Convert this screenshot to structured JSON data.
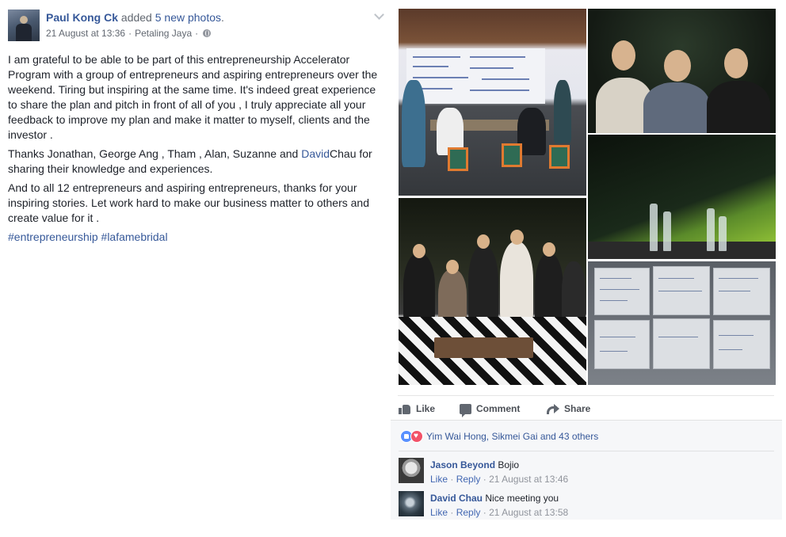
{
  "post": {
    "author": "Paul Kong Ck",
    "action_prefix": "added",
    "action_link": "5 new photos",
    "action_suffix": ".",
    "date": "21 August at 13:36",
    "location": "Petaling Jaya",
    "separator": "·",
    "privacy_icon": "globe-icon",
    "text": {
      "p1": "I am grateful to be able to be part of this entrepreneurship Accelerator Program with a group of entrepreneurs and aspiring entrepreneurs over the weekend. Tiring but inspiring at the same time. It's indeed great experience to share the plan and pitch in front of all of you , I truly appreciate all your feedback to improve my plan and make it matter to myself, clients and the investor .",
      "p2_before": "Thanks Jonathan, George Ang , Tham , Alan, Suzanne and ",
      "p2_mention": "David",
      "p2_after": "Chau for sharing their knowledge and experiences.",
      "p3": "And to all 12 entrepreneurs and aspiring entrepreneurs, thanks for your inspiring stories. Let work hard to make our business matter to others and create value for it .",
      "hashtag1": "#entrepreneurship",
      "hashtag2": "#lafamebridal"
    }
  },
  "actions": {
    "like": "Like",
    "comment": "Comment",
    "share": "Share"
  },
  "reactions": {
    "names": "Yim Wai Hong, Sikmei Gai and 43 others",
    "icons": [
      "like-reaction-icon",
      "love-reaction-icon"
    ],
    "colors": {
      "like": "#5890ff",
      "love": "#f25268"
    }
  },
  "comments": [
    {
      "name": "Jason Beyond",
      "text": "Bojio",
      "like": "Like",
      "reply": "Reply",
      "time": "21 August at 13:46"
    },
    {
      "name": "David Chau",
      "text": "Nice meeting you",
      "like": "Like",
      "reply": "Reply",
      "time": "21 August at 13:58"
    }
  ],
  "colors": {
    "link": "#365899",
    "text": "#1d2129",
    "meta": "#616770",
    "box_bg": "#f6f7f9"
  }
}
